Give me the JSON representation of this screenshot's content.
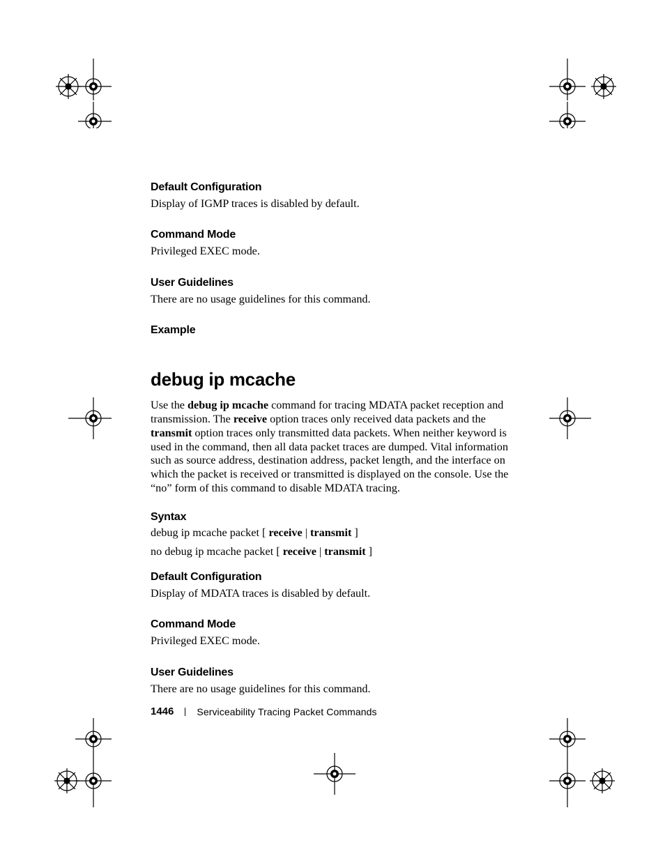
{
  "sections": {
    "default_cfg_1": {
      "heading": "Default Configuration",
      "body": "Display of IGMP traces is disabled by default."
    },
    "cmd_mode_1": {
      "heading": "Command Mode",
      "body": "Privileged EXEC mode."
    },
    "user_gl_1": {
      "heading": "User Guidelines",
      "body": "There are no usage guidelines for this command."
    },
    "example": {
      "heading": "Example"
    },
    "syntax": {
      "heading": "Syntax"
    },
    "default_cfg_2": {
      "heading": "Default Configuration",
      "body": "Display of MDATA traces is disabled by default."
    },
    "cmd_mode_2": {
      "heading": "Command Mode",
      "body": "Privileged EXEC mode."
    },
    "user_gl_2": {
      "heading": "User Guidelines",
      "body": "There are no usage guidelines for this command."
    }
  },
  "command": {
    "title": "debug ip mcache",
    "intro_prefix": "Use the ",
    "intro_cmd": "debug ip mcache",
    "intro_mid1": " command for tracing MDATA packet reception and transmission. The ",
    "intro_kw_receive": "receive",
    "intro_mid2": " option traces only received data packets and the ",
    "intro_kw_transmit": "transmit",
    "intro_suffix": " option traces only transmitted data packets. When neither keyword is used in the command, then all data packet traces are dumped. Vital information such as source address, destination address, packet length, and the interface on which the packet is received or transmitted is displayed on the console. Use the “no” form of this command to disable MDATA tracing."
  },
  "syntax": {
    "line1": {
      "p1": "debug ip mcache packet",
      "br": " [ ",
      "kw1": "receive",
      "sep": " | ",
      "kw2": "transmit",
      "close": " ]"
    },
    "line2": {
      "p1": "no debug ip mcache packet",
      "br": " [ ",
      "kw1": "receive",
      "sep": " | ",
      "kw2": "transmit",
      "close": " ]"
    }
  },
  "footer": {
    "page_number": "1446",
    "trail": "Serviceability Tracing Packet Commands"
  }
}
